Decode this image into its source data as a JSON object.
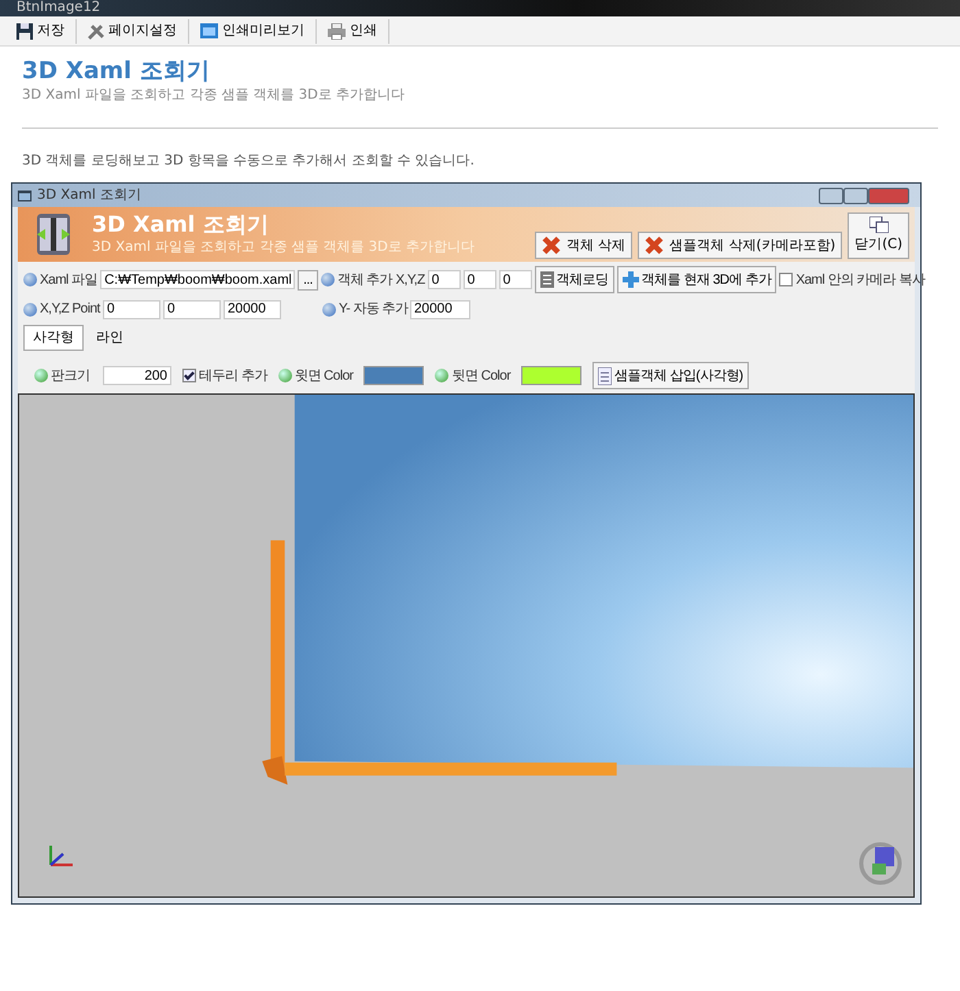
{
  "app_title": "BtnImage12",
  "toolbar": [
    {
      "label": "저장",
      "kind": "save"
    },
    {
      "label": "페이지설정",
      "kind": "tools"
    },
    {
      "label": "인쇄미리보기",
      "kind": "preview"
    },
    {
      "label": "인쇄",
      "kind": "print"
    }
  ],
  "page": {
    "title": "3D Xaml 조회기",
    "subtitle": "3D Xaml 파일을 조회하고 각종 샘플 객체를 3D로 추가합니다",
    "description": "3D 객체를 로딩해보고 3D 항목을 수동으로 추가해서 조회할 수 있습니다."
  },
  "window": {
    "title": "3D Xaml 조회기",
    "banner_title": "3D Xaml 조회기",
    "banner_subtitle": "3D Xaml 파일을 조회하고 각종 샘플 객체를 3D로 추가합니다",
    "buttons": [
      {
        "label": "객체 삭제",
        "kind": "delete"
      },
      {
        "label": "샘플객체 삭제(카메라포함)",
        "kind": "delete"
      },
      {
        "label": "닫기(C)",
        "kind": "close"
      }
    ]
  },
  "form": {
    "xaml_file": {
      "label": "Xaml 파일",
      "value": "C:₩Temp₩boom₩boom.xaml"
    },
    "browse_button": "...",
    "add_xyz": {
      "label": "객체 추가 X,Y,Z",
      "values": [
        "0",
        "0",
        "0"
      ]
    },
    "load_button": "객체로딩",
    "add_button": "객체를 현재 3D에 추가",
    "camera_copy": {
      "label": "Xaml 안의 카메라 복사",
      "checked": false
    },
    "point": {
      "label": "X,Y,Z Point",
      "values": [
        "0",
        "0",
        "20000"
      ]
    },
    "y_auto": {
      "label": "Y- 자동 추가",
      "value": "20000"
    }
  },
  "tabs": [
    {
      "label": "사각형",
      "selected": true
    },
    {
      "label": "라인",
      "selected": false
    }
  ],
  "rect_options": {
    "size": {
      "label": "판크기",
      "value": "200"
    },
    "border": {
      "label": "테두리 추가",
      "checked": true
    },
    "top_color": {
      "label": "윗면 Color",
      "color": "#4a7fb5"
    },
    "back_color": {
      "label": "뒷면 Color",
      "color": "#adff2f"
    },
    "insert_button": "샘플객체 삽입(사각형)"
  }
}
